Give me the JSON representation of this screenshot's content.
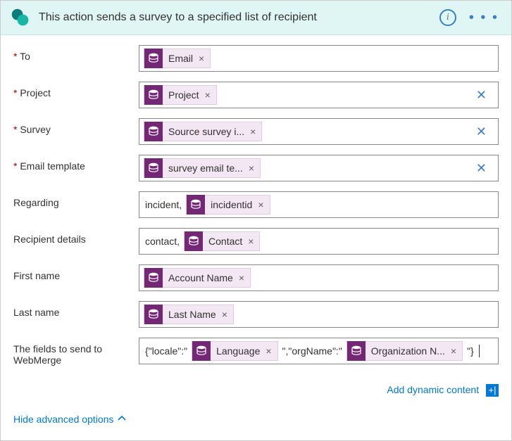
{
  "header": {
    "title": "This action sends a survey to a specified list of recipient"
  },
  "icons": {
    "info_glyph": "i",
    "ellipsis_glyph": "• • •",
    "clear_glyph": "✕",
    "token_x": "×",
    "dyn_badge": "+|"
  },
  "labels": {
    "to": "To",
    "project": "Project",
    "survey": "Survey",
    "email_template": "Email template",
    "regarding": "Regarding",
    "recipient_details": "Recipient details",
    "first_name": "First name",
    "last_name": "Last name",
    "webmerge": "The fields to send to WebMerge",
    "add_dynamic": "Add dynamic content",
    "hide_advanced": "Hide advanced options"
  },
  "tokens": {
    "email": "Email",
    "project": "Project",
    "survey": "Source survey i...",
    "email_template": "survey email te...",
    "incidentid": "incidentid",
    "contact": "Contact",
    "account_name": "Account Name",
    "last_name": "Last Name",
    "language": "Language",
    "org_name": "Organization N..."
  },
  "text": {
    "regarding_prefix": "incident,",
    "recipient_prefix": "contact,",
    "wm_open": "{\"locale\":\"",
    "wm_mid": "\",\"orgName\":\"",
    "wm_close": "\"}"
  }
}
